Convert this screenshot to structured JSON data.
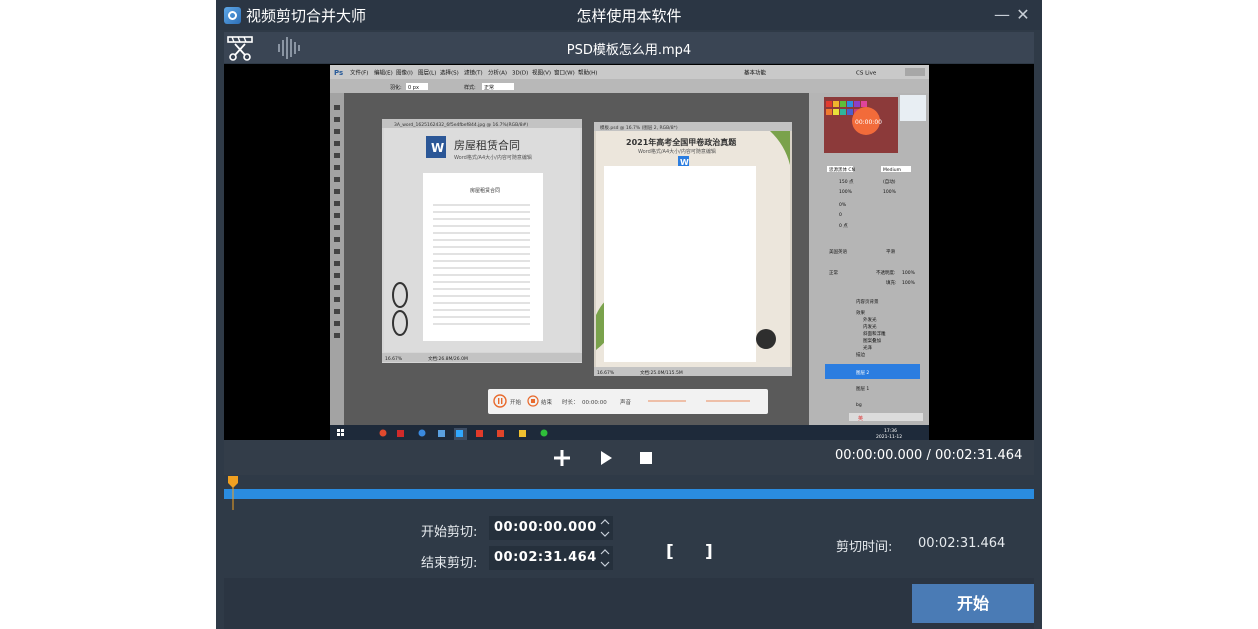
{
  "window": {
    "app_name": "视频剪切合并大师",
    "title": "怎样使用本软件",
    "minimize_glyph": "—",
    "close_glyph": "✕"
  },
  "toolbar": {
    "file_name": "PSD模板怎么用.mp4"
  },
  "player": {
    "current_time": "00:00:00.000",
    "separator": "/",
    "total_time": "00:02:31.464",
    "progress": 0
  },
  "video_frame": {
    "doc1": {
      "tab": "3A_word_1625162432_6f5e4fbef844.jpg @ 16.7%(RGB/8#)",
      "title": "房屋租赁合同",
      "subtitle": "Word格式/A4大小/内容可随意编辑",
      "page_heading": "房屋租赁合同",
      "zoom": "16.67%",
      "doc_info": "文档:26.8M/26.0M"
    },
    "doc2": {
      "tab": "模板.psd @ 16.7% (图层 2, RGB/8*)",
      "title": "2021年高考全国甲卷政治真题",
      "subtitle": "Word格式/A4大小/内容可随意编辑",
      "zoom": "16.67%",
      "doc_info": "文档:25.0M/115.5M"
    },
    "recorder": {
      "timer": "00:00:00",
      "start": "开始",
      "stop": "结束",
      "length_label": "时长：",
      "length": "00:00:00",
      "sound": "声音"
    },
    "layers": [
      "内容页背景",
      "效果",
      "外发光",
      "内发光",
      "斜面和浮雕",
      "图案叠加",
      "光泽",
      "描边",
      "图层 2",
      "图层 1",
      "bg"
    ],
    "panel": {
      "font": "思源黑体 CN",
      "weight": "Medium",
      "size": "150 点",
      "leading": "(自动)",
      "scale_v": "100%",
      "scale_h": "100%",
      "tracking": "0%",
      "kerning": "0",
      "baseline": "0 点",
      "lang": "美国英语",
      "aa": "平滑",
      "blend": "正常",
      "opacity": "100%",
      "fill": "100%",
      "opacity_label": "不透明度:",
      "fill_label": "填充:"
    },
    "menus": [
      "文件(F)",
      "编辑(E)",
      "图像(I)",
      "图层(L)",
      "选择(S)",
      "滤镜(T)",
      "分析(A)",
      "3D(D)",
      "视图(V)",
      "窗口(W)",
      "帮助(H)"
    ],
    "essentials": "基本功能",
    "cs_live": "CS Live",
    "feather": "羽化:",
    "feather_val": "0 px",
    "style_label": "样式:",
    "style_val": "正常",
    "clock_time": "17:36",
    "clock_date": "2021-11-12",
    "tray_lang": "英"
  },
  "trim": {
    "start_label": "开始剪切:",
    "start_value": "00:00:00.000",
    "end_label": "结束剪切:",
    "end_value": "00:02:31.464",
    "bracket_open": "[",
    "bracket_close": "]",
    "duration_label": "剪切时间:",
    "duration_value": "00:02:31.464"
  },
  "footer": {
    "start_button": "开始"
  },
  "colors": {
    "window_bg": "#2f3a47",
    "accent": "#2a8ce0",
    "start_button": "#4a7bb5",
    "playhead": "#f0a020"
  }
}
